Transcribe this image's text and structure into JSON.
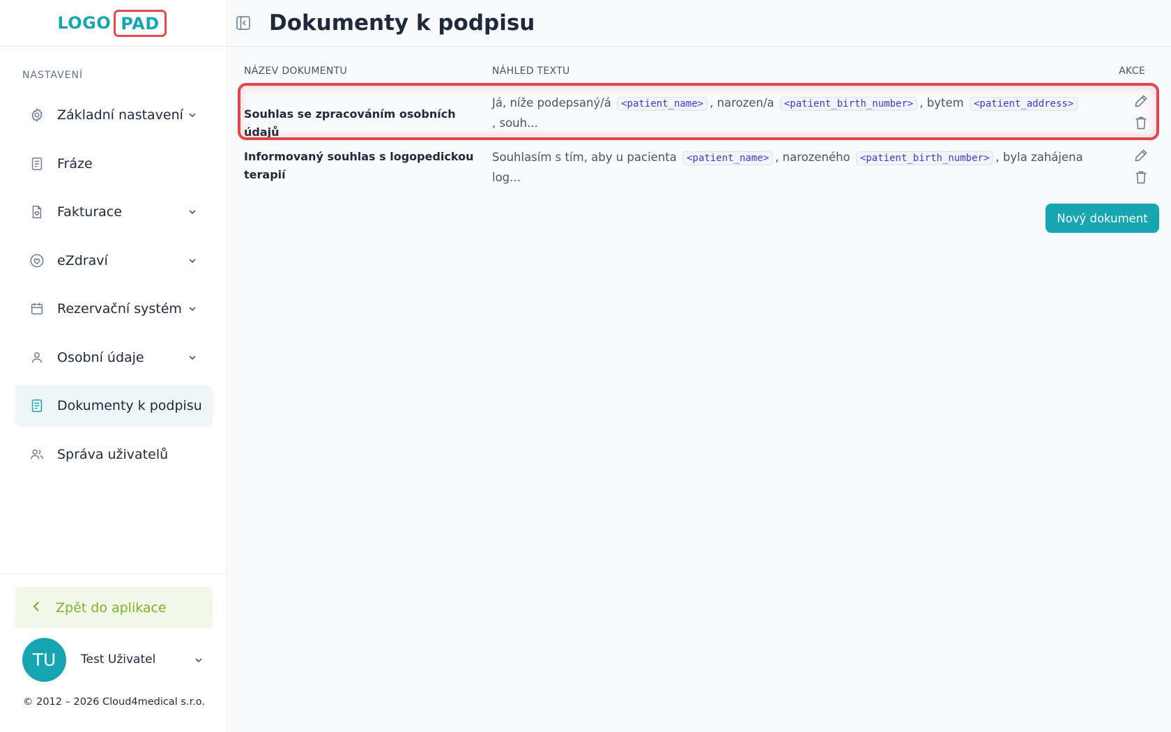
{
  "logo": {
    "part1": "LOGO",
    "part2": "PAD"
  },
  "sidebar": {
    "section_title": "NASTAVENÍ",
    "items": [
      {
        "label": "Základní nastavení",
        "icon": "gear-icon",
        "has_chevron": true
      },
      {
        "label": "Fráze",
        "icon": "document-icon",
        "has_chevron": false
      },
      {
        "label": "Fakturace",
        "icon": "invoice-icon",
        "has_chevron": true
      },
      {
        "label": "eZdraví",
        "icon": "heart-icon",
        "has_chevron": true
      },
      {
        "label": "Rezervační systém",
        "icon": "calendar-icon",
        "has_chevron": true
      },
      {
        "label": "Osobní údaje",
        "icon": "user-icon",
        "has_chevron": true
      },
      {
        "label": "Dokumenty k podpisu",
        "icon": "document-icon",
        "has_chevron": false,
        "active": true
      },
      {
        "label": "Správa uživatelů",
        "icon": "users-icon",
        "has_chevron": false
      }
    ],
    "back_label": "Zpět do aplikace",
    "user": {
      "initials": "TU",
      "name": "Test Uživatel"
    },
    "copyright": "© 2012 – 2026 Cloud4medical s.r.o."
  },
  "header": {
    "title": "Dokumenty k podpisu"
  },
  "table": {
    "columns": [
      "NÁZEV DOKUMENTU",
      "NÁHLED TEXTU",
      "AKCE"
    ],
    "rows": [
      {
        "name": "Souhlas se zpracováním osobních údajů",
        "preview": {
          "t1": "Já, níže podepsaný/á",
          "tag1": "<patient_name>",
          "t2": ", narozen/a",
          "tag2": "<patient_birth_number>",
          "t3": ", bytem",
          "tag3": "<patient_address>",
          "t4": ", souh..."
        }
      },
      {
        "name": "Informovaný souhlas s logopedickou terapií",
        "preview": {
          "t1": "Souhlasím s tím, aby u pacienta",
          "tag1": "<patient_name>",
          "t2": ", narozeného",
          "tag2": "<patient_birth_number>",
          "t3": ", byla zahájena log..."
        }
      }
    ]
  },
  "new_document_label": "Nový dokument",
  "colors": {
    "accent": "#17a5b2",
    "highlight": "#e0474c",
    "back_green": "#7cb324"
  }
}
